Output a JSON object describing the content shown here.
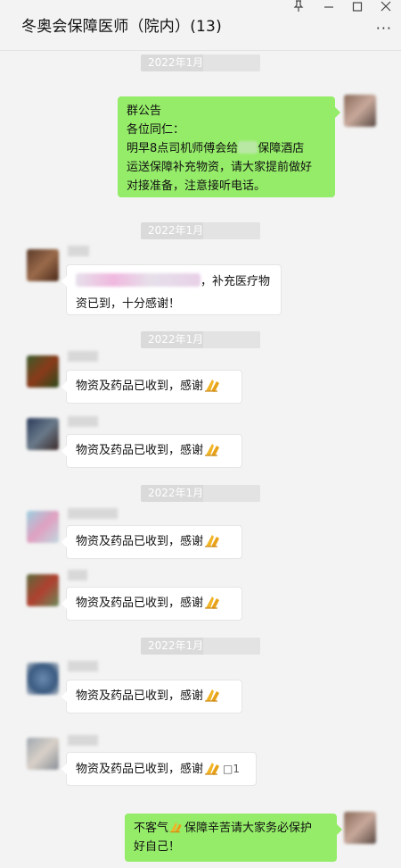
{
  "window": {
    "title": "冬奥会保障医师（院内）(13)",
    "pin_glyph": "⚲",
    "minimize_glyph": "—",
    "maximize_glyph": "☐",
    "close_glyph": "✕",
    "more_glyph": "···"
  },
  "timestamps": [
    "2022年1月",
    "2022年1月",
    "2022年1月",
    "2022年1月",
    "2022年1月"
  ],
  "messages": {
    "announcement": {
      "line1": "群公告",
      "line2": "各位同仁：",
      "line3_a": "明早8点司机师傅会给",
      "line3_b": "保障酒店",
      "line4": "运送保障补充物资，请大家提前做好",
      "line5": "对接准备，注意接听电话。"
    },
    "thanks_first": {
      "line1": "，补充医疗物",
      "line2": "资已到，十分感谢！"
    },
    "received": "物资及药品已收到，感谢",
    "received_suffix": "□1",
    "reply_a": "不客气",
    "reply_b": "保障辛苦请大家务必保护",
    "reply_c": "好自己！"
  },
  "icons": [
    "pin-icon",
    "minimize-icon",
    "maximize-icon",
    "close-icon",
    "more-icon",
    "pray-emoji"
  ]
}
